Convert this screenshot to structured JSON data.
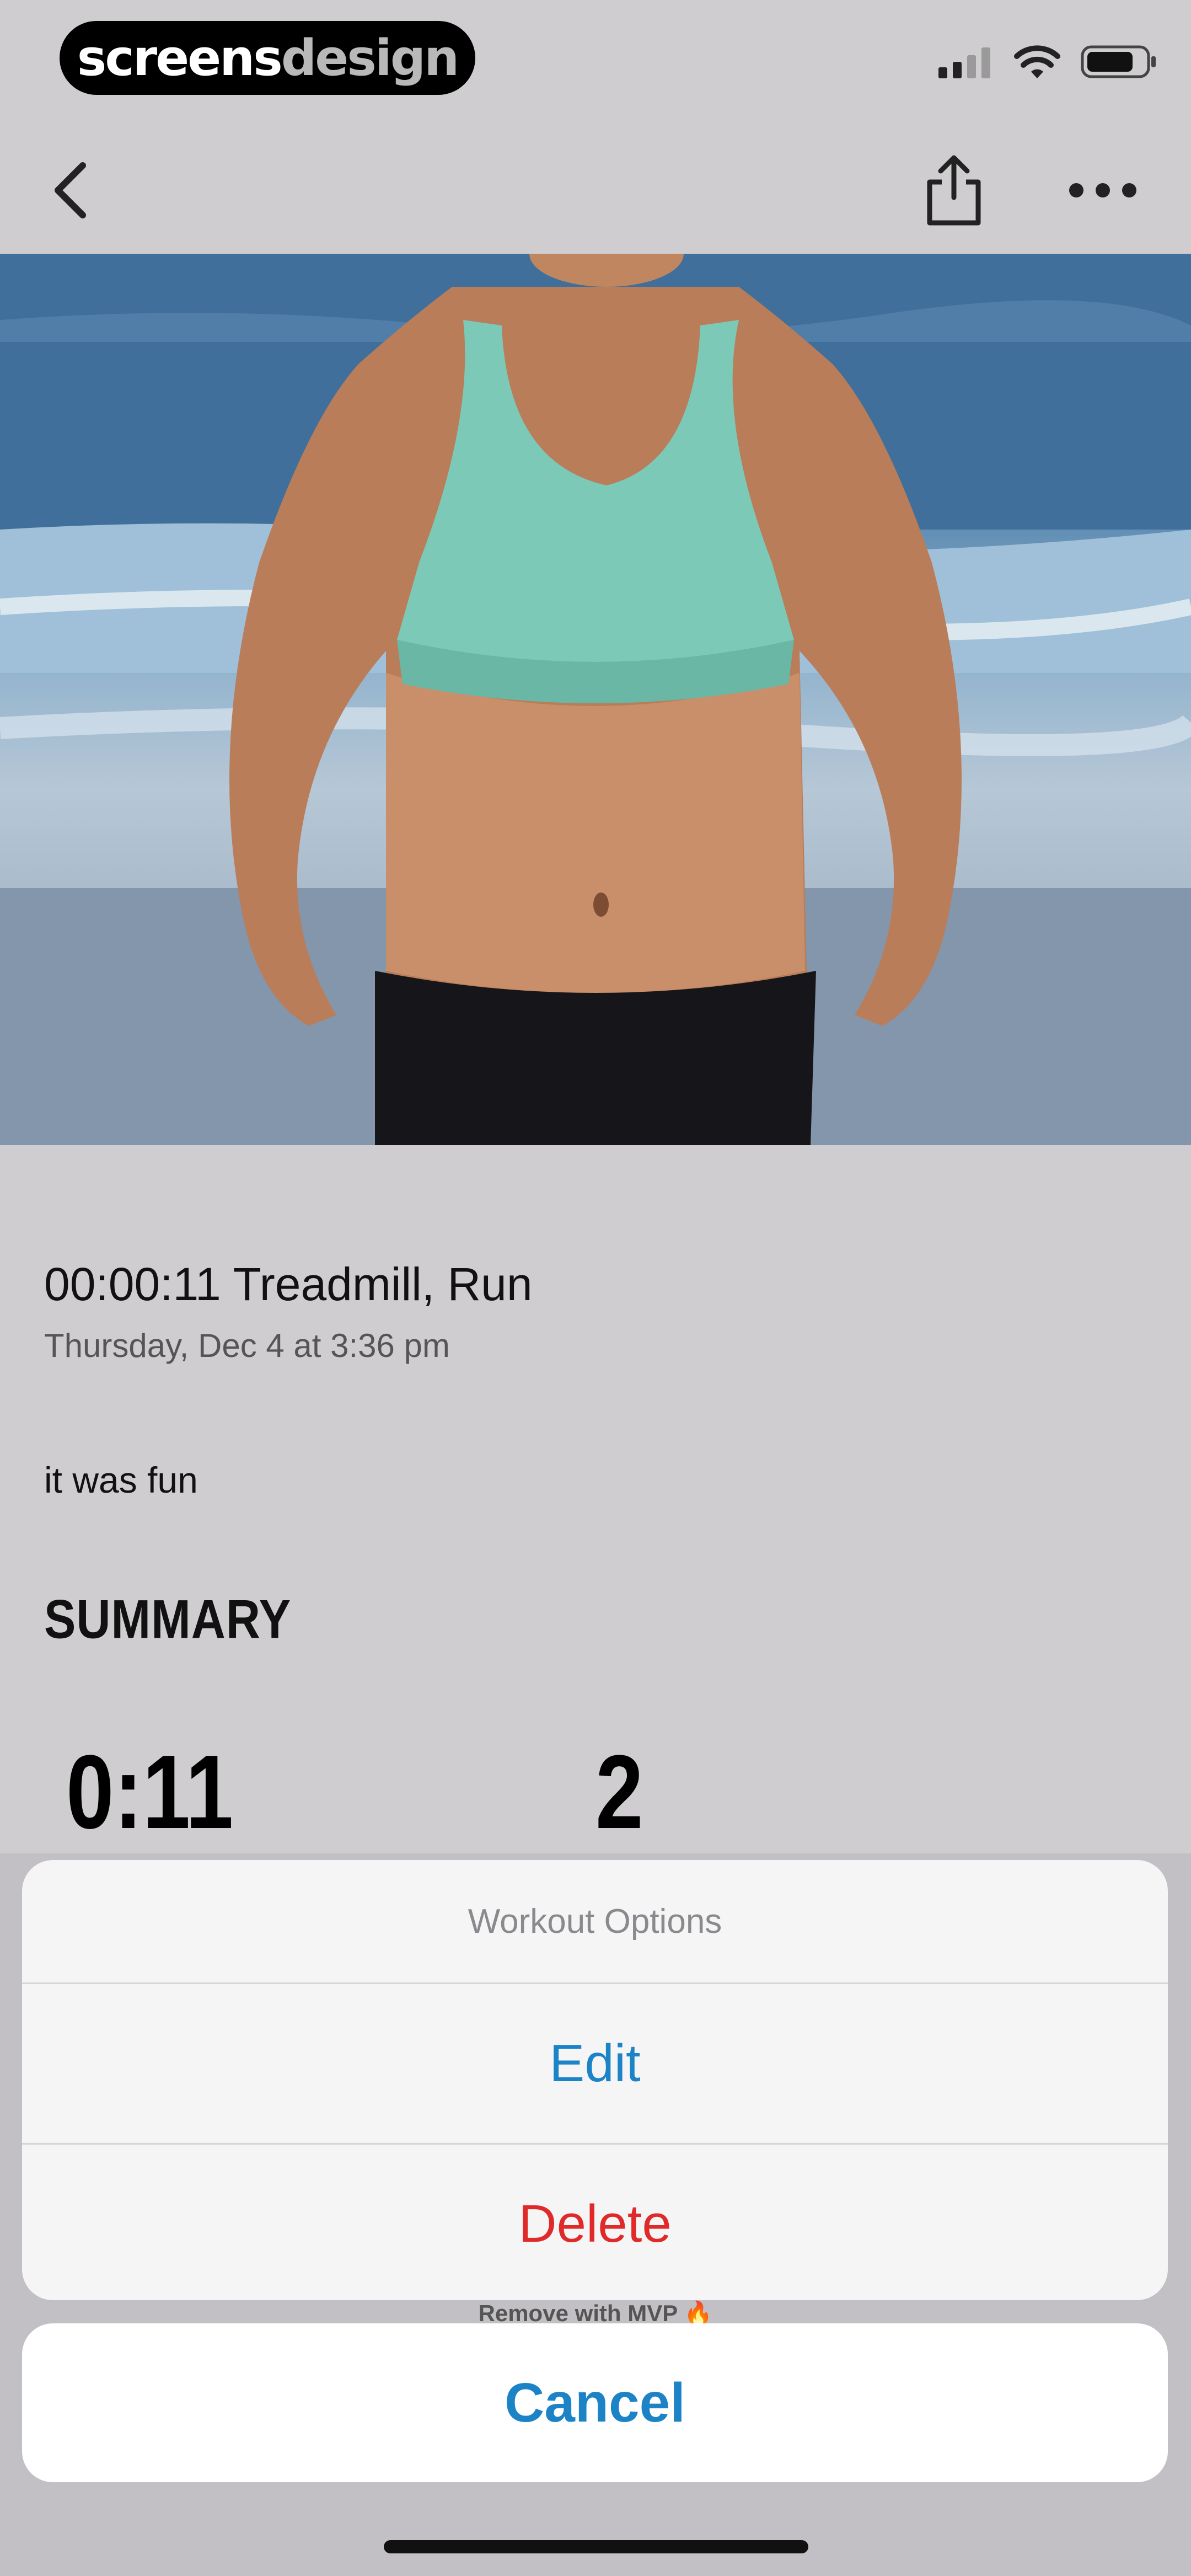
{
  "brand": {
    "primary": "screens",
    "secondary": "design"
  },
  "status_bar": {
    "signal": "signal-icon",
    "wifi": "wifi-icon",
    "battery": "battery-icon"
  },
  "nav": {
    "back_icon": "chevron-left-icon",
    "share_icon": "share-icon",
    "more_icon": "more-icon"
  },
  "workout": {
    "title": "00:00:11 Treadmill, Run",
    "date": "Thursday, Dec 4 at 3:36 pm",
    "note": "it was fun"
  },
  "summary": {
    "heading": "SUMMARY",
    "stats": [
      "0:11",
      "2"
    ]
  },
  "action_sheet": {
    "title": "Workout Options",
    "edit_label": "Edit",
    "delete_label": "Delete",
    "cancel_label": "Cancel"
  },
  "footer_note": "Remove with MVP",
  "colors": {
    "accent_blue": "#1c84c6",
    "destructive_red": "#e02a2a",
    "sports_bra": "#7cc9b8"
  }
}
